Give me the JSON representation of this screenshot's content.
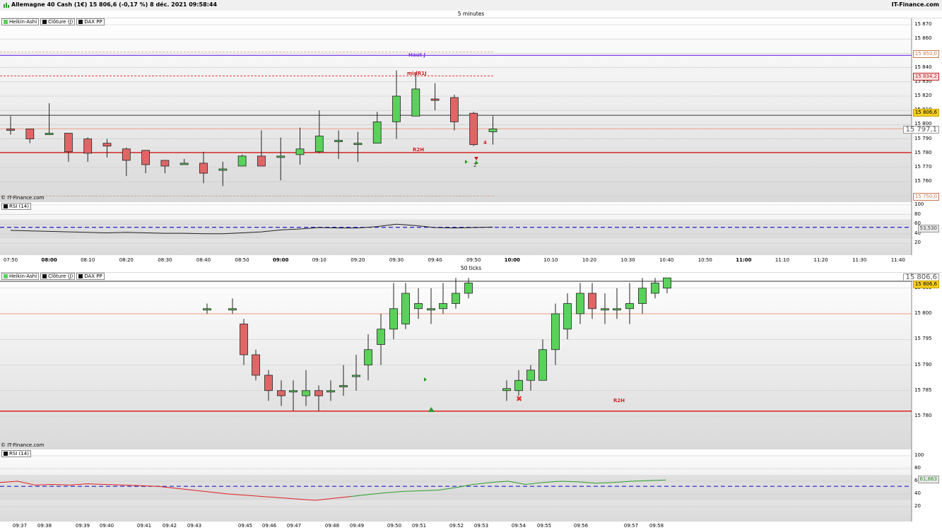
{
  "window": {
    "title": "Allemagne 40 Cash (1€) 15 806,6 (-0,17 %) 8 déc. 2021 09:58:44",
    "brand": "IT-Finance.com"
  },
  "colors": {
    "bull": "#5ad25a",
    "bear": "#e06666",
    "support": "#e02020",
    "haut": "#7b3fe4",
    "rsi_level": "#2020d0"
  },
  "legend": [
    "Heikin-Ashi",
    "Clôture (J)",
    "DAX PP"
  ],
  "rsi_label": "RSI (14)",
  "watermark": "© IT-Finance.com",
  "top": {
    "caption": "5 minutes",
    "y_ticks": [
      "15 870",
      "15 860",
      "15 850",
      "15 840",
      "15 830",
      "15 820",
      "15 810",
      "15 800",
      "15 790",
      "15 780",
      "15 770",
      "15 760",
      "15 750"
    ],
    "price_labels": [
      "15 850,0",
      "15 834,2",
      "15 806,6",
      "15 797,1",
      "15 750,0"
    ],
    "annotations": {
      "haut": "Haut J",
      "mid": "midR1J",
      "r2h": "R2H",
      "count_a": "4",
      "count_b": "2"
    },
    "rsi_ticks": [
      "100",
      "80",
      "60",
      "40",
      "20"
    ],
    "rsi_value": "53,530",
    "x_labels": [
      "07:50",
      "08:00",
      "08:10",
      "08:20",
      "08:30",
      "08:40",
      "08:50",
      "09:00",
      "09:10",
      "09:20",
      "09:30",
      "09:40",
      "09:50",
      "10:00",
      "10:10",
      "10:20",
      "10:30",
      "10:40",
      "10:50",
      "11:00",
      "11:10",
      "11:20",
      "11:30",
      "11:40"
    ]
  },
  "bottom": {
    "caption": "50 ticks",
    "y_ticks": [
      "15 805",
      "15 800",
      "15 795",
      "15 790",
      "15 785",
      "15 780"
    ],
    "price_labels": [
      "15 806,6",
      "15 806,6"
    ],
    "annotations": {
      "r2h": "R2H"
    },
    "rsi_ticks": [
      "100",
      "80",
      "60",
      "40",
      "20"
    ],
    "rsi_value": "61,863",
    "x_labels": [
      "09:37",
      "09:38",
      "09:39",
      "09:40",
      "09:41",
      "09:42",
      "09:43",
      "09:45",
      "09:46",
      "09:47",
      "09:48",
      "09:49",
      "09:50",
      "09:51",
      "09:52",
      "09:53",
      "09:54",
      "09:55",
      "09:56",
      "09:57",
      "09:58"
    ]
  },
  "chart_data": [
    {
      "type": "candlestick",
      "title": "5 minutes",
      "ylim": [
        15745,
        15875
      ],
      "x": [
        "07:50",
        "07:55",
        "08:00",
        "08:05",
        "08:10",
        "08:15",
        "08:20",
        "08:25",
        "08:30",
        "08:35",
        "08:40",
        "08:45",
        "08:50",
        "08:55",
        "09:00",
        "09:05",
        "09:10",
        "09:15",
        "09:20",
        "09:25",
        "09:30",
        "09:35",
        "09:40",
        "09:45",
        "09:50",
        "09:55"
      ],
      "open": [
        15797,
        15797,
        15794,
        15794,
        15790,
        15787,
        15783,
        15782,
        15775,
        15773,
        15773,
        15768,
        15771,
        15778,
        15778,
        15779,
        15781,
        15788,
        15787,
        15787,
        15802,
        15806,
        15818,
        15819,
        15808,
        15795
      ],
      "close": [
        15796,
        15790,
        15794,
        15781,
        15780,
        15785,
        15775,
        15772,
        15771,
        15773,
        15766,
        15769,
        15778,
        15771,
        15778,
        15783,
        15792,
        15789,
        15787,
        15802,
        15820,
        15825,
        15817,
        15802,
        15786,
        15797
      ],
      "high": [
        15806,
        15796,
        15815,
        15794,
        15791,
        15790,
        15784,
        15782,
        15775,
        15776,
        15781,
        15774,
        15779,
        15796,
        15791,
        15798,
        15810,
        15796,
        15795,
        15809,
        15838,
        15836,
        15829,
        15821,
        15809,
        15806
      ],
      "low": [
        15793,
        15787,
        15793,
        15774,
        15774,
        15777,
        15764,
        15766,
        15766,
        15772,
        15759,
        15757,
        15771,
        15771,
        15761,
        15772,
        15780,
        15776,
        15774,
        15787,
        15790,
        15806,
        15810,
        15796,
        15785,
        15786
      ],
      "levels": {
        "haut_j": 15850.0,
        "mid_r1j": 15834.2,
        "last": 15806.6,
        "r2h": 15780.5,
        "pivot": 15797.1,
        "low_ref": 15750.0
      },
      "rsi": {
        "ylim": [
          0,
          100
        ],
        "level": 53.53,
        "values": [
          47,
          46,
          45,
          44,
          43,
          42,
          43,
          42,
          41,
          41,
          40,
          40,
          42,
          44,
          48,
          50,
          53,
          52,
          52,
          55,
          60,
          57,
          53,
          52,
          53,
          54
        ]
      }
    },
    {
      "type": "candlestick",
      "title": "50 ticks",
      "ylim": [
        15778,
        15808
      ],
      "x": [
        "09:37",
        "09:38",
        "09:39",
        "09:40",
        "09:41",
        "09:42",
        "09:43",
        "09:45",
        "09:46",
        "09:47",
        "09:48",
        "09:49",
        "09:50",
        "09:51",
        "09:52",
        "09:53",
        "09:54",
        "09:55",
        "09:56",
        "09:57",
        "09:58"
      ],
      "open": [
        15808,
        15808,
        15807,
        15806,
        15807,
        15805,
        15800,
        15801,
        15801,
        15798,
        15792,
        15788,
        15785,
        15785,
        15784,
        15785,
        15785,
        15786,
        15788,
        15790,
        15794,
        15797,
        15798,
        15801,
        15801,
        15801,
        15802,
        15804
      ],
      "close": [
        15807,
        15807,
        15806,
        15807,
        15805,
        15800,
        15801,
        15801,
        15801,
        15792,
        15788,
        15785,
        15784,
        15785,
        15785,
        15784,
        15785,
        15786,
        15788,
        15793,
        15797,
        15801,
        15804,
        15802,
        15801,
        15802,
        15804,
        15806
      ],
      "high": [
        15808,
        15808,
        15808,
        15808,
        15808,
        15806,
        15803,
        15802,
        15803,
        15799,
        15793,
        15789,
        15787,
        15787,
        15789,
        15786,
        15787,
        15790,
        15792,
        15796,
        15800,
        15806,
        15806,
        15805,
        15805,
        15806,
        15807,
        15807
      ],
      "low": [
        15805,
        15804,
        15804,
        15805,
        15799,
        15799,
        15798,
        15800,
        15800,
        15790,
        15787,
        15783,
        15782,
        15781,
        15782,
        15781,
        15783,
        15784,
        15785,
        15787,
        15790,
        15795,
        15797,
        15799,
        15798,
        15800,
        15801,
        15803
      ],
      "levels": {
        "last": 15806.6,
        "pivot": 15800.0,
        "r2h": 15781.0
      },
      "rsi": {
        "ylim": [
          0,
          100
        ],
        "level": 52,
        "values": [
          58,
          60,
          54,
          55,
          54,
          56,
          55,
          54,
          53,
          52,
          49,
          46,
          43,
          40,
          38,
          36,
          34,
          32,
          30,
          33,
          36,
          39,
          42,
          44,
          45,
          46,
          50,
          55,
          58,
          60,
          55,
          58,
          60,
          59,
          57,
          58,
          60,
          61,
          62
        ]
      }
    }
  ]
}
